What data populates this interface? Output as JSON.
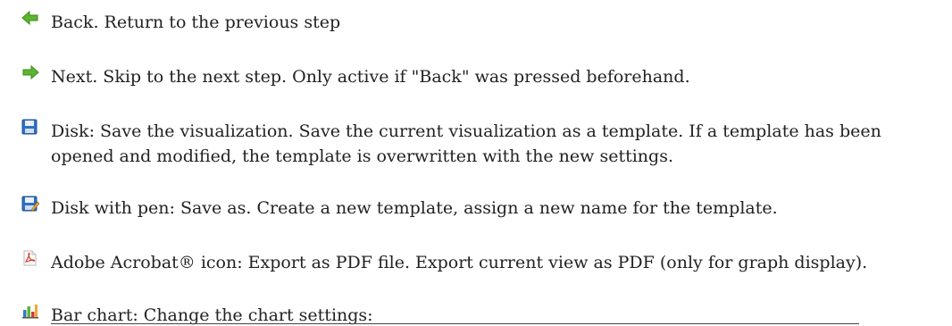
{
  "items": [
    {
      "icon": "green-left-arrow-icon",
      "text": "Back. Return to the previous step"
    },
    {
      "icon": "green-right-arrow-icon",
      "text": "Next. Skip to the next step. Only active if \"Back\" was pressed beforehand."
    },
    {
      "icon": "floppy-disk-icon",
      "text": "Disk: Save the visualization. Save the current visualization as a template. If a template has been opened and modified, the template is overwritten with the new settings."
    },
    {
      "icon": "floppy-disk-pen-icon",
      "text": "Disk with pen: Save as. Create a new template, assign a new name for the template."
    },
    {
      "icon": "pdf-icon",
      "text": "Adobe Acrobat® icon: Export as PDF file. Export current view as PDF (only for graph display)."
    },
    {
      "icon": "bar-chart-icon",
      "text": "Bar chart: Change the chart settings:"
    }
  ],
  "colors": {
    "arrow_green": "#5cb531",
    "disk_blue": "#2f6fc2",
    "pdf_red": "#d23a2c"
  }
}
